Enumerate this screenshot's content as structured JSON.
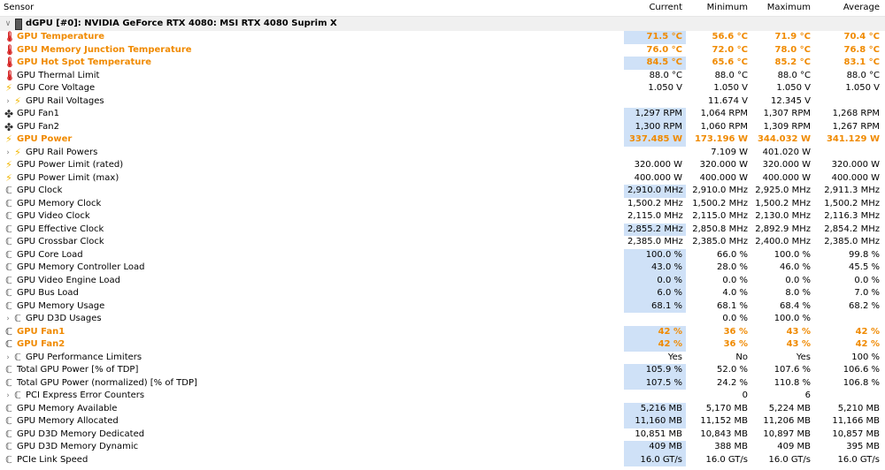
{
  "header": {
    "sensor": "Sensor",
    "current": "Current",
    "minimum": "Minimum",
    "maximum": "Maximum",
    "average": "Average"
  },
  "group": {
    "label": "dGPU [#0]: NVIDIA GeForce RTX 4080: MSI RTX 4080 Suprim X",
    "expander": "∨"
  },
  "rows": [
    {
      "name": "GPU Temperature",
      "icon": "thermometer-icon",
      "hl": true,
      "sel": true,
      "cur": "71.5 °C",
      "min": "56.6 °C",
      "max": "71.9 °C",
      "avg": "70.4 °C"
    },
    {
      "name": "GPU Memory Junction Temperature",
      "icon": "thermometer-icon",
      "hl": true,
      "sel": false,
      "cur": "76.0 °C",
      "min": "72.0 °C",
      "max": "78.0 °C",
      "avg": "76.8 °C"
    },
    {
      "name": "GPU Hot Spot Temperature",
      "icon": "thermometer-icon",
      "hl": true,
      "sel": true,
      "cur": "84.5 °C",
      "min": "65.6 °C",
      "max": "85.2 °C",
      "avg": "83.1 °C"
    },
    {
      "name": "GPU Thermal Limit",
      "icon": "thermometer-icon",
      "cur": "88.0 °C",
      "min": "88.0 °C",
      "max": "88.0 °C",
      "avg": "88.0 °C"
    },
    {
      "name": "GPU Core Voltage",
      "icon": "lightning-icon",
      "cur": "1.050 V",
      "min": "1.050 V",
      "max": "1.050 V",
      "avg": "1.050 V"
    },
    {
      "name": "GPU Rail Voltages",
      "icon": "lightning-icon",
      "expander": true,
      "cur": "",
      "min": "11.674 V",
      "max": "12.345 V",
      "avg": ""
    },
    {
      "name": "GPU Fan1",
      "icon": "fan-icon",
      "sel": true,
      "cur": "1,297 RPM",
      "min": "1,064 RPM",
      "max": "1,307 RPM",
      "avg": "1,268 RPM"
    },
    {
      "name": "GPU Fan2",
      "icon": "fan-icon",
      "sel": true,
      "cur": "1,300 RPM",
      "min": "1,060 RPM",
      "max": "1,309 RPM",
      "avg": "1,267 RPM"
    },
    {
      "name": "GPU Power",
      "icon": "lightning-icon",
      "hl": true,
      "sel": true,
      "cur": "337.485 W",
      "min": "173.196 W",
      "max": "344.032 W",
      "avg": "341.129 W"
    },
    {
      "name": "GPU Rail Powers",
      "icon": "lightning-icon",
      "expander": true,
      "cur": "",
      "min": "7.109 W",
      "max": "401.020 W",
      "avg": ""
    },
    {
      "name": "GPU Power Limit (rated)",
      "icon": "lightning-icon",
      "cur": "320.000 W",
      "min": "320.000 W",
      "max": "320.000 W",
      "avg": "320.000 W"
    },
    {
      "name": "GPU Power Limit (max)",
      "icon": "lightning-icon",
      "cur": "400.000 W",
      "min": "400.000 W",
      "max": "400.000 W",
      "avg": "400.000 W"
    },
    {
      "name": "GPU Clock",
      "icon": "clock-icon",
      "sel": true,
      "cur": "2,910.0 MHz",
      "min": "2,910.0 MHz",
      "max": "2,925.0 MHz",
      "avg": "2,911.3 MHz"
    },
    {
      "name": "GPU Memory Clock",
      "icon": "clock-icon",
      "cur": "1,500.2 MHz",
      "min": "1,500.2 MHz",
      "max": "1,500.2 MHz",
      "avg": "1,500.2 MHz"
    },
    {
      "name": "GPU Video Clock",
      "icon": "clock-icon",
      "cur": "2,115.0 MHz",
      "min": "2,115.0 MHz",
      "max": "2,130.0 MHz",
      "avg": "2,116.3 MHz"
    },
    {
      "name": "GPU Effective Clock",
      "icon": "clock-icon",
      "sel": true,
      "cur": "2,855.2 MHz",
      "min": "2,850.8 MHz",
      "max": "2,892.9 MHz",
      "avg": "2,854.2 MHz"
    },
    {
      "name": "GPU Crossbar Clock",
      "icon": "clock-icon",
      "cur": "2,385.0 MHz",
      "min": "2,385.0 MHz",
      "max": "2,400.0 MHz",
      "avg": "2,385.0 MHz"
    },
    {
      "name": "GPU Core Load",
      "icon": "clock-icon",
      "sel": true,
      "cur": "100.0 %",
      "min": "66.0 %",
      "max": "100.0 %",
      "avg": "99.8 %"
    },
    {
      "name": "GPU Memory Controller Load",
      "icon": "clock-icon",
      "sel": true,
      "cur": "43.0 %",
      "min": "28.0 %",
      "max": "46.0 %",
      "avg": "45.5 %"
    },
    {
      "name": "GPU Video Engine Load",
      "icon": "clock-icon",
      "sel": true,
      "cur": "0.0 %",
      "min": "0.0 %",
      "max": "0.0 %",
      "avg": "0.0 %"
    },
    {
      "name": "GPU Bus Load",
      "icon": "clock-icon",
      "sel": true,
      "cur": "6.0 %",
      "min": "4.0 %",
      "max": "8.0 %",
      "avg": "7.0 %"
    },
    {
      "name": "GPU Memory Usage",
      "icon": "clock-icon",
      "sel": true,
      "cur": "68.1 %",
      "min": "68.1 %",
      "max": "68.4 %",
      "avg": "68.2 %"
    },
    {
      "name": "GPU D3D Usages",
      "icon": "clock-icon",
      "expander": true,
      "cur": "",
      "min": "0.0 %",
      "max": "100.0 %",
      "avg": ""
    },
    {
      "name": "GPU Fan1",
      "icon": "clock-icon",
      "hl": true,
      "sel": true,
      "cur": "42 %",
      "min": "36 %",
      "max": "43 %",
      "avg": "42 %"
    },
    {
      "name": "GPU Fan2",
      "icon": "clock-icon",
      "hl": true,
      "sel": true,
      "cur": "42 %",
      "min": "36 %",
      "max": "43 %",
      "avg": "42 %"
    },
    {
      "name": "GPU Performance Limiters",
      "icon": "clock-icon",
      "expander": true,
      "cur": "Yes",
      "min": "No",
      "max": "Yes",
      "avg": "100 %"
    },
    {
      "name": "Total GPU Power [% of TDP]",
      "icon": "clock-icon",
      "sel": true,
      "cur": "105.9 %",
      "min": "52.0 %",
      "max": "107.6 %",
      "avg": "106.6 %"
    },
    {
      "name": "Total GPU Power (normalized) [% of TDP]",
      "icon": "clock-icon",
      "sel": true,
      "cur": "107.5 %",
      "min": "24.2 %",
      "max": "110.8 %",
      "avg": "106.8 %"
    },
    {
      "name": "PCI Express Error Counters",
      "icon": "clock-icon",
      "expander": true,
      "cur": "",
      "min": "0",
      "max": "6",
      "avg": ""
    },
    {
      "name": "GPU Memory Available",
      "icon": "clock-icon",
      "sel": true,
      "cur": "5,216 MB",
      "min": "5,170 MB",
      "max": "5,224 MB",
      "avg": "5,210 MB"
    },
    {
      "name": "GPU Memory Allocated",
      "icon": "clock-icon",
      "sel": true,
      "cur": "11,160 MB",
      "min": "11,152 MB",
      "max": "11,206 MB",
      "avg": "11,166 MB"
    },
    {
      "name": "GPU D3D Memory Dedicated",
      "icon": "clock-icon",
      "cur": "10,851 MB",
      "min": "10,843 MB",
      "max": "10,897 MB",
      "avg": "10,857 MB"
    },
    {
      "name": "GPU D3D Memory Dynamic",
      "icon": "clock-icon",
      "sel": true,
      "cur": "409 MB",
      "min": "388 MB",
      "max": "409 MB",
      "avg": "395 MB"
    },
    {
      "name": "PCIe Link Speed",
      "icon": "clock-icon",
      "sel": true,
      "cur": "16.0 GT/s",
      "min": "16.0 GT/s",
      "max": "16.0 GT/s",
      "avg": "16.0 GT/s"
    }
  ],
  "icons": {
    "thermometer-icon": "🌡",
    "lightning-icon": "⚡",
    "fan-icon": "✤",
    "clock-icon": "ℂ"
  },
  "colors": {
    "highlight": "#f08a00",
    "selection": "#cfe1f7",
    "group_bg": "#f0f0f0"
  }
}
